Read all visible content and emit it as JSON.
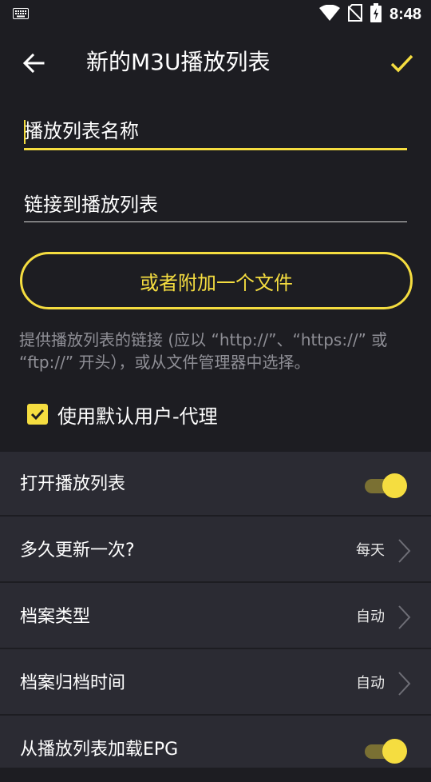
{
  "status_bar": {
    "time": "8:48",
    "icons": [
      "keyboard-icon",
      "wifi-icon",
      "no-sim-icon",
      "battery-charging-icon"
    ]
  },
  "app_bar": {
    "title": "新的M3U播放列表",
    "back_icon": "arrow-left-icon",
    "confirm_icon": "check-icon"
  },
  "form": {
    "name_field": {
      "placeholder": "播放列表名称",
      "value": ""
    },
    "link_field": {
      "placeholder": "链接到播放列表",
      "value": ""
    },
    "attach_button": "或者附加一个文件",
    "hint": "提供播放列表的链接 (应以 “http://”、“https://” 或 “ftp://” 开头），或从文件管理器中选择。",
    "default_agent": {
      "label": "使用默认用户-代理",
      "checked": true
    }
  },
  "settings": [
    {
      "label": "打开播放列表",
      "type": "toggle",
      "on": true
    },
    {
      "label": "多久更新一次?",
      "type": "value",
      "value": "每天"
    },
    {
      "label": "档案类型",
      "type": "value",
      "value": "自动"
    },
    {
      "label": "档案归档时间",
      "type": "value",
      "value": "自动"
    },
    {
      "label": "从播放列表加载EPG",
      "type": "toggle",
      "on": true
    }
  ],
  "colors": {
    "accent": "#f5dd40",
    "background": "#1d1d22",
    "panel": "#2b2b33",
    "hint_text": "#8f8f96"
  }
}
